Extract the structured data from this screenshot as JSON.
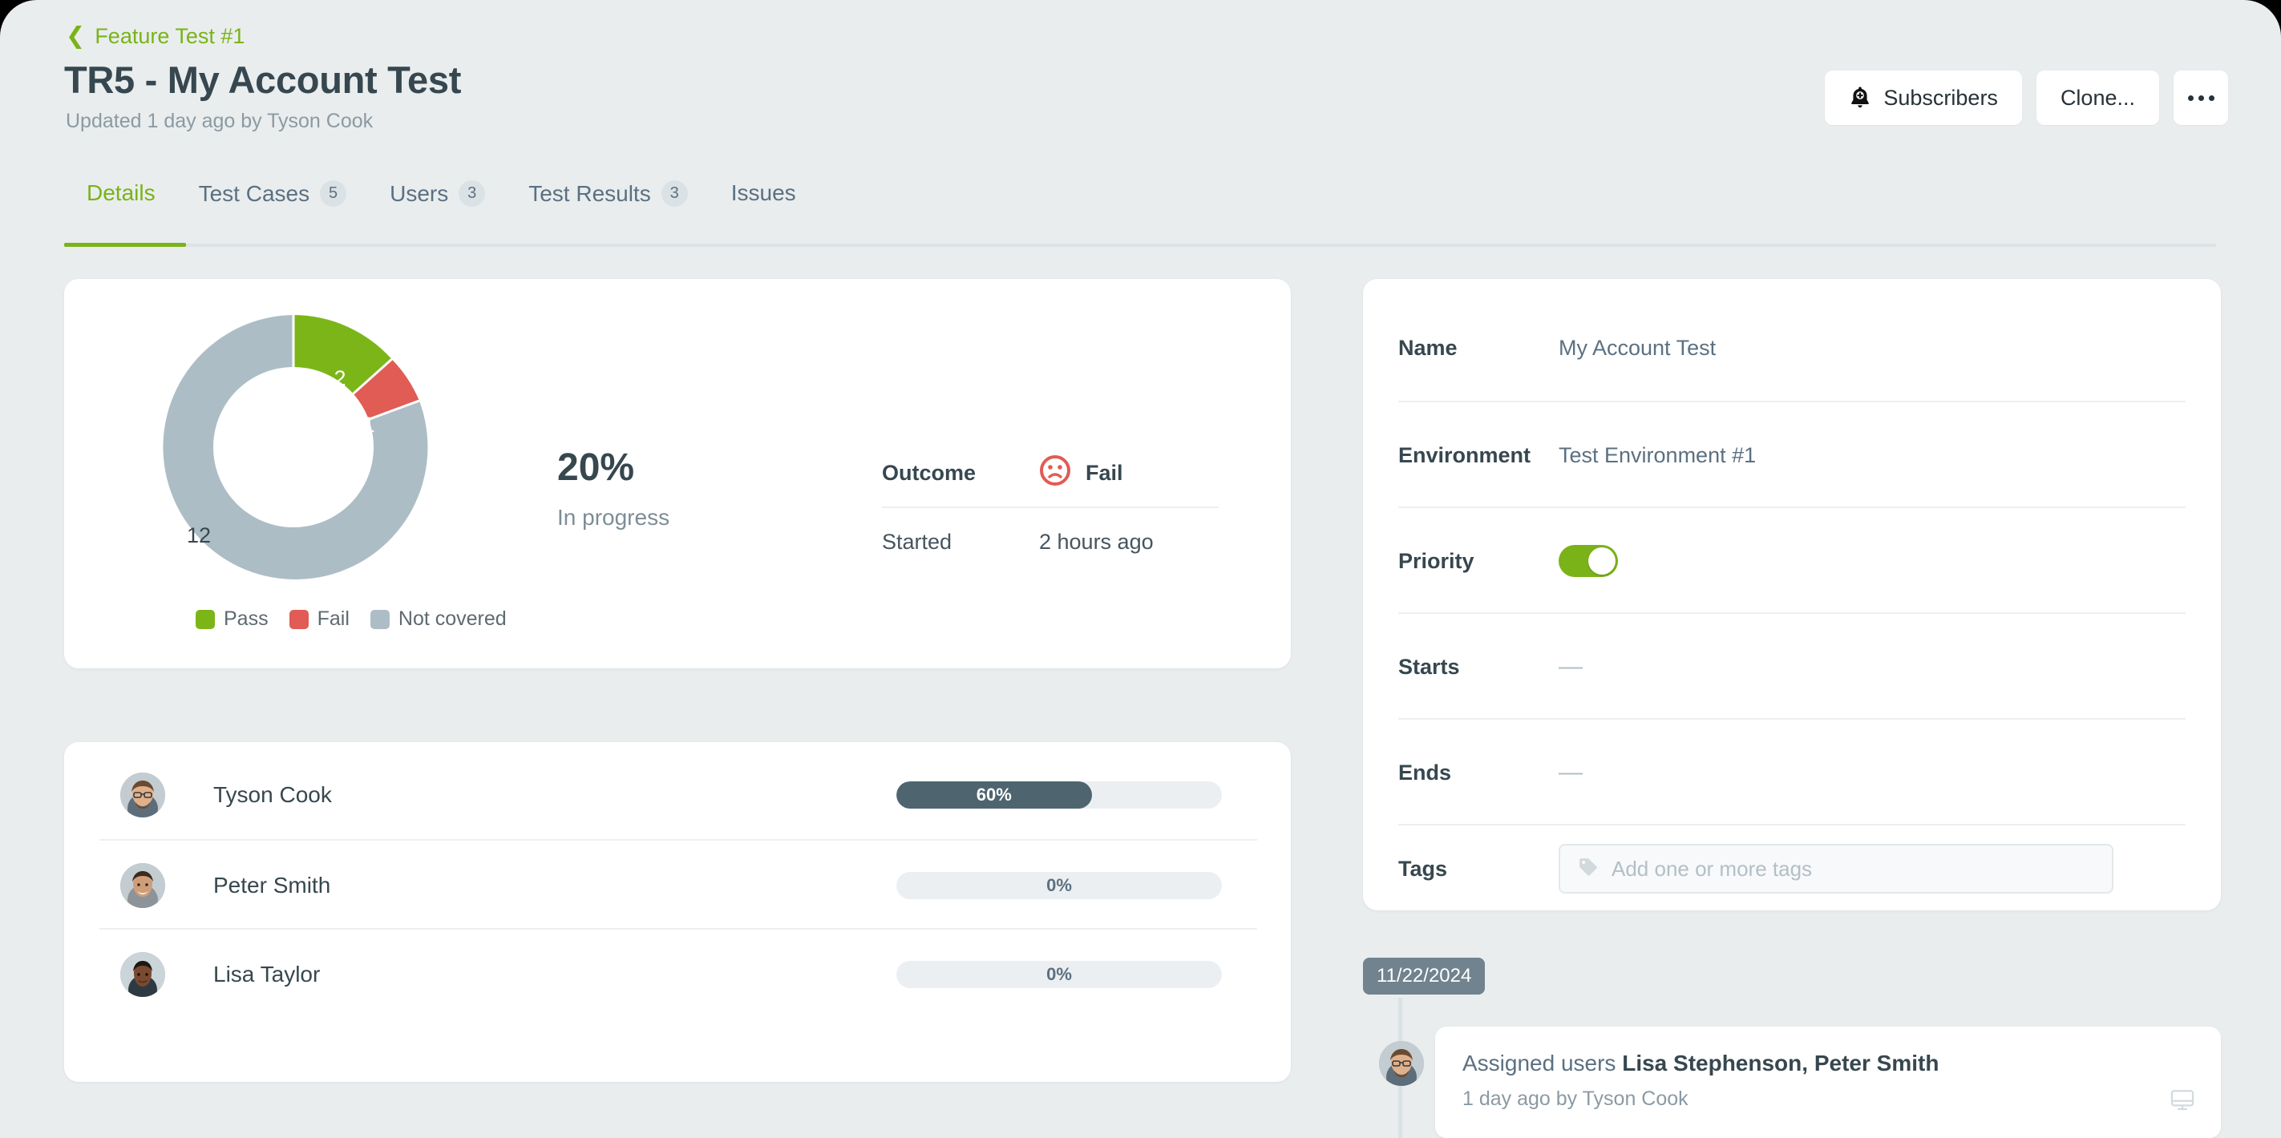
{
  "header": {
    "breadcrumb": "Feature Test #1",
    "breadcrumb_icon": "chevron-left-icon",
    "title": "TR5 - My Account Test",
    "subtitle": "Updated 1 day ago by Tyson Cook",
    "buttons": {
      "subscribers": "Subscribers",
      "subscribers_icon": "bell-plus-icon",
      "clone": "Clone...",
      "more_icon": "ellipsis-icon"
    }
  },
  "tabs": [
    {
      "label": "Details",
      "count": "",
      "active": true
    },
    {
      "label": "Test Cases",
      "count": "5",
      "active": false
    },
    {
      "label": "Users",
      "count": "3",
      "active": false
    },
    {
      "label": "Test Results",
      "count": "3",
      "active": false
    },
    {
      "label": "Issues",
      "count": "",
      "active": false
    }
  ],
  "chart_data": {
    "type": "pie",
    "title": "",
    "categories": [
      "Pass",
      "Fail",
      "Not covered"
    ],
    "values": [
      2,
      1,
      12
    ],
    "labels": [
      "2",
      "1",
      "12"
    ],
    "colors": [
      "#7cb518",
      "#e05c54",
      "#adbdc6"
    ],
    "total": 15,
    "legend_position": "bottom",
    "donut": true
  },
  "progress": {
    "percent": "20%",
    "status": "In progress"
  },
  "outcome": {
    "key": "Outcome",
    "value": "Fail",
    "icon": "sad-face-icon",
    "icon_color": "#e05c54",
    "started_key": "Started",
    "started_value": "2 hours ago"
  },
  "users": [
    {
      "name": "Tyson Cook",
      "progress": "60%",
      "progress_value": 60
    },
    {
      "name": "Peter Smith",
      "progress": "0%",
      "progress_value": 0
    },
    {
      "name": "Lisa Taylor",
      "progress": "0%",
      "progress_value": 0
    }
  ],
  "details": {
    "rows": [
      {
        "key": "Name",
        "value": "My Account Test"
      },
      {
        "key": "Environment",
        "value": "Test Environment #1"
      },
      {
        "key": "Priority",
        "value": ""
      },
      {
        "key": "Starts",
        "value": "—"
      },
      {
        "key": "Ends",
        "value": "—"
      },
      {
        "key": "Tags",
        "value": ""
      }
    ],
    "priority_on": true,
    "tags_placeholder": "Add one or more tags",
    "tags_icon": "tag-icon"
  },
  "activity": {
    "date": "11/22/2024",
    "entry_prefix": "Assigned users ",
    "entry_users": "Lisa Stephenson, Peter Smith",
    "entry_meta": "1 day ago by Tyson Cook",
    "device_icon": "monitor-icon"
  },
  "colors": {
    "accent_green": "#7ab317",
    "pass": "#7cb518",
    "fail": "#e05c54",
    "not_covered": "#adbdc6",
    "progress_fill": "#4e6570",
    "page_bg": "#e9edee",
    "badge_bg": "#70838e"
  }
}
